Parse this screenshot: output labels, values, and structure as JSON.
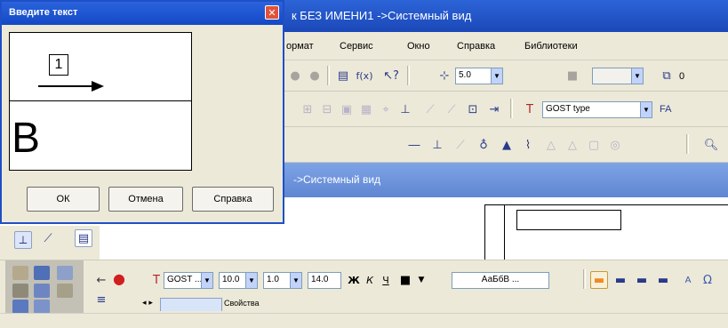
{
  "app": {
    "title": "к БЕЗ ИМЕНИ1 ->Системный вид"
  },
  "menu": {
    "items": [
      "ормат",
      "Сервис",
      "Окно",
      "Справка",
      "Библиотеки"
    ]
  },
  "toolbar": {
    "step_value": "5.0",
    "layer_value": "0",
    "font_combo": "GOST type",
    "font_combo_tail": "FA"
  },
  "document": {
    "title": "->Системный вид"
  },
  "dialog": {
    "title": "Введите текст",
    "preview_number": "1",
    "preview_letter": "В",
    "buttons": {
      "ok": "ОК",
      "cancel": "Отмена",
      "help": "Справка"
    }
  },
  "propbar": {
    "font": "GOST ...",
    "size": "10.0",
    "ratio": "1.0",
    "height": "14.0",
    "bold": "Ж",
    "italic": "К",
    "underline": "Ч",
    "sample": "АаБбВ ...",
    "tabs": [
      "Свойства"
    ]
  },
  "colors": {
    "dialog_title": "#1448c6",
    "app_title": "#1b48b8",
    "doc_title": "#5f86d2",
    "panel": "#ece9d8",
    "accent_orange": "#f08a24"
  },
  "icons": {
    "close": "close-icon",
    "arrow": "arrow-right-icon"
  }
}
